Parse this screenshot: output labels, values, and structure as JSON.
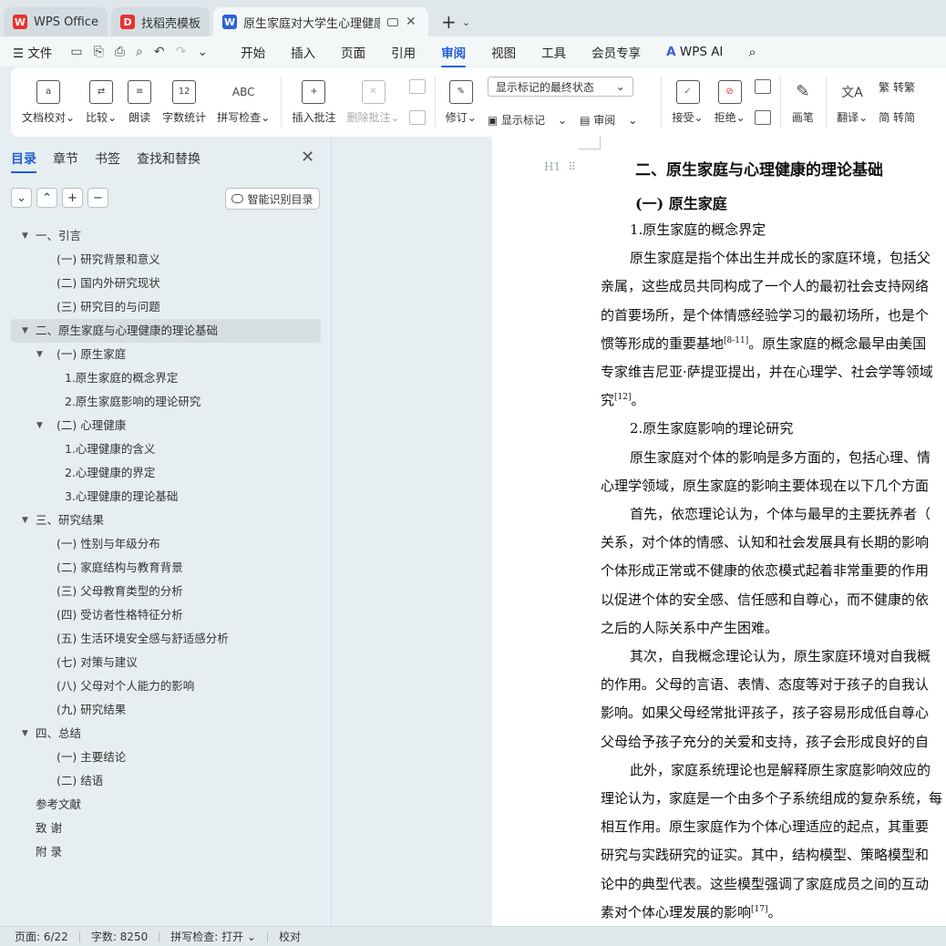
{
  "tabs": [
    {
      "title": "WPS Office",
      "icon": "wps-logo-icon",
      "color": "#e8322f"
    },
    {
      "title": "找稻壳模板",
      "icon": "docer-logo-icon",
      "color": "#e8322f"
    },
    {
      "title": "原生家庭对大学生心理健康影响",
      "icon": "writer-logo-icon",
      "color": "#2b63d9"
    }
  ],
  "menu": {
    "file": "文件",
    "items": [
      "开始",
      "插入",
      "页面",
      "引用",
      "审阅",
      "视图",
      "工具",
      "会员专享"
    ],
    "active": "审阅",
    "wps_ai": "WPS AI"
  },
  "ribbon": {
    "proof": "文档校对",
    "compare": "比较",
    "read": "朗读",
    "wordcount": "字数统计",
    "spell": "拼写检查",
    "spell_icon_text": "ABC",
    "wordcount_icon_text": "12",
    "insert_comment": "插入批注",
    "delete_comment": "删除批注",
    "revise": "修订",
    "markup_select": "显示标记的最终状态",
    "show_markup": "显示标记",
    "review": "审阅",
    "accept": "接受",
    "reject": "拒绝",
    "pen": "画笔",
    "translate": "翻译",
    "to_trad": "转繁",
    "to_simp": "转简"
  },
  "leftpane": {
    "tabs": [
      "目录",
      "章节",
      "书签",
      "查找和替换"
    ],
    "active_tab": "目录",
    "smart_toc": "智能识别目录"
  },
  "toc": [
    {
      "text": "一、引言",
      "level": 1,
      "arrow": true
    },
    {
      "text": "(一) 研究背景和意义",
      "level": 2
    },
    {
      "text": "(二) 国内外研究现状",
      "level": 2
    },
    {
      "text": "(三) 研究目的与问题",
      "level": 2
    },
    {
      "text": "二、原生家庭与心理健康的理论基础",
      "level": 1,
      "arrow": true,
      "selected": true
    },
    {
      "text": "(一) 原生家庭",
      "level": 2,
      "arrow": true
    },
    {
      "text": "1.原生家庭的概念界定",
      "level": 3
    },
    {
      "text": "2.原生家庭影响的理论研究",
      "level": 3
    },
    {
      "text": "(二) 心理健康",
      "level": 2,
      "arrow": true
    },
    {
      "text": "1.心理健康的含义",
      "level": 3
    },
    {
      "text": "2.心理健康的界定",
      "level": 3
    },
    {
      "text": "3.心理健康的理论基础",
      "level": 3
    },
    {
      "text": "三、研究结果",
      "level": 1,
      "arrow": true
    },
    {
      "text": "(一)   性别与年级分布",
      "level": 2
    },
    {
      "text": "(二) 家庭结构与教育背景",
      "level": 2
    },
    {
      "text": "(三) 父母教育类型的分析",
      "level": 2
    },
    {
      "text": "(四) 受访者性格特征分析",
      "level": 2
    },
    {
      "text": "(五) 生活环境安全感与舒适感分析",
      "level": 2
    },
    {
      "text": "(七) 对策与建议",
      "level": 2
    },
    {
      "text": "(八) 父母对个人能力的影响",
      "level": 2
    },
    {
      "text": "(九) 研究结果",
      "level": 2
    },
    {
      "text": "四、总结",
      "level": 1,
      "arrow": true
    },
    {
      "text": "(一) 主要结论",
      "level": 2
    },
    {
      "text": "(二) 结语",
      "level": 2
    },
    {
      "text": "参考文献",
      "level": 1
    },
    {
      "text": "致   谢",
      "level": 1
    },
    {
      "text": "附   录",
      "level": 1
    }
  ],
  "doc": {
    "heading_marker": "H1",
    "heading": "二、原生家庭与心理健康的理论基础",
    "subheading": "(一) 原生家庭",
    "lines": [
      "1.原生家庭的概念界定",
      "原生家庭是指个体出生并成长的家庭环境，包括父",
      "亲属，这些成员共同构成了一个人的最初社会支持网络",
      "的首要场所，是个体情感经验学习的最初场所，也是个",
      "惯等形成的重要基地",
      "专家维吉尼亚·萨提亚提出，并在心理学、社会学等领域",
      "究",
      "2.原生家庭影响的理论研究",
      "原生家庭对个体的影响是多方面的，包括心理、情",
      "心理学领域，原生家庭的影响主要体现在以下几个方面",
      "首先，依恋理论认为，个体与最早的主要抚养者（",
      "关系，对个体的情感、认知和社会发展具有长期的影响",
      "个体形成正常或不健康的依恋模式起着非常重要的作用",
      "以促进个体的安全感、信任感和自尊心，而不健康的依",
      "之后的人际关系中产生困难。",
      "其次，自我概念理论认为，原生家庭环境对自我概",
      "的作用。父母的言语、表情、态度等对于孩子的自我认",
      "影响。如果父母经常批评孩子，孩子容易形成低自尊心",
      "父母给予孩子充分的关爱和支持，孩子会形成良好的自",
      "此外，家庭系统理论也是解释原生家庭影响效应的",
      "理论认为，家庭是一个由多个子系统组成的复杂系统，每",
      "相互作用。原生家庭作为个体心理适应的起点，其重要",
      "研究与实践研究的证实。其中，结构模型、策略模型和",
      "论中的典型代表。这些模型强调了家庭成员之间的互动",
      "素对个体心理发展的影响"
    ],
    "line4_tail": "。原生家庭的概念最早由美国",
    "line6_tail": "。",
    "line_last_tail": "。",
    "cite_a": "[8-11]",
    "cite_b": "[12]",
    "cite_c": "[17]"
  },
  "status": {
    "page": "页面: 6/22",
    "words": "字数: 8250",
    "spell": "拼写检查: 打开",
    "proof": "校对"
  }
}
